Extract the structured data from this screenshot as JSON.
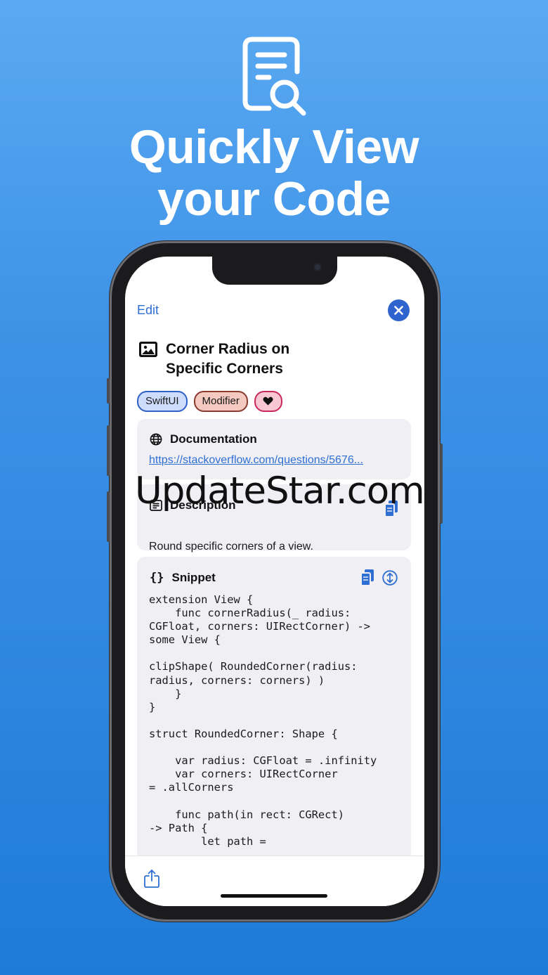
{
  "hero": {
    "headline_line1": "Quickly View",
    "headline_line2": "your Code",
    "icon": "document-magnifier-icon"
  },
  "app": {
    "edit_label": "Edit",
    "close_icon": "close-icon",
    "title_line1": "Corner Radius on",
    "title_line2": "Specific Corners",
    "title_icon": "photo-icon",
    "tags": [
      "SwiftUI",
      "Modifier"
    ],
    "favorite_icon": "heart-icon",
    "documentation": {
      "heading": "Documentation",
      "icon": "globe-icon",
      "link": "https://stackoverflow.com/questions/5676..."
    },
    "description": {
      "heading": "Description",
      "icon": "text-box-icon",
      "text": "Round specific corners of a view."
    },
    "snippet": {
      "heading": "Snippet",
      "icon_text": "{}",
      "code": "extension View {\n    func cornerRadius(_ radius:\nCGFloat, corners: UIRectCorner) ->\nsome View {\n\nclipShape( RoundedCorner(radius:\nradius, corners: corners) )\n    }\n}\n\nstruct RoundedCorner: Shape {\n\n    var radius: CGFloat = .infinity\n    var corners: UIRectCorner\n= .allCorners\n\n    func path(in rect: CGRect)\n-> Path {\n        let path ="
    },
    "share_icon": "share-icon"
  },
  "watermark": "UpdateStar.com",
  "colors": {
    "accent": "#2f6fd3",
    "background_top": "#5aa9f2",
    "background_bottom": "#1f7bd8"
  }
}
